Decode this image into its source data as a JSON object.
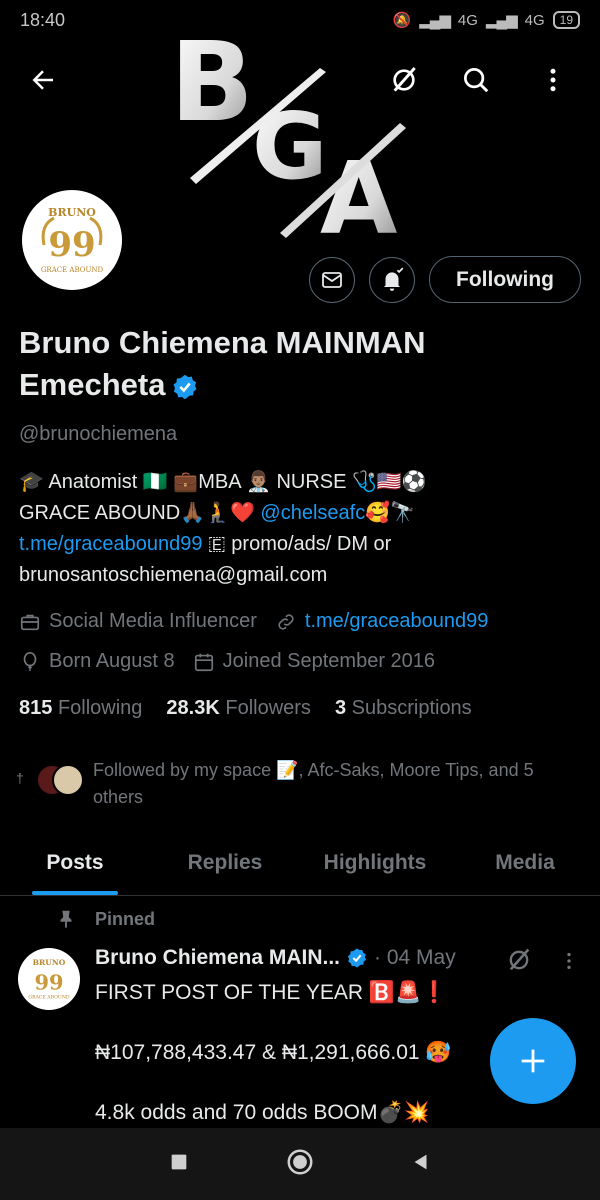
{
  "status_bar": {
    "time": "18:40",
    "network_1": "4G",
    "network_2": "4G",
    "battery": "19"
  },
  "banner": {
    "logo_text": "BGA"
  },
  "avatar": {
    "top_text": "BRUNO",
    "number": "99",
    "bottom_text": "GRACE ABOUND"
  },
  "profile": {
    "following_button": "Following",
    "name_line1": "Bruno Chiemena MAINMAN",
    "name_line2": "Emecheta",
    "handle": "@brunochiemena",
    "bio": {
      "line1": "🎓 Anatomist 🇳🇬 💼MBA 👨🏽‍⚕️ NURSE 🩺🇺🇸⚽",
      "line2_a": "GRACE ABOUND🙏🏾🧎❤️ ",
      "line2_link": "@chelseafc",
      "line2_b": "🥰🔭",
      "line3_link": "t.me/graceabound99",
      "line3_b": " 🇪 promo/ads/ DM or",
      "line4": "brunosantoschiemena@gmail.com"
    },
    "category": "Social Media Influencer",
    "website": "t.me/graceabound99",
    "born": "Born August 8",
    "joined": "Joined September 2016",
    "following_count": "815",
    "following_label": "Following",
    "followers_count": "28.3K",
    "followers_label": "Followers",
    "subs_count": "3",
    "subs_label": "Subscriptions",
    "followed_by": "Followed by my space 📝, Afc-Saks, Moore Tips, and 5 others"
  },
  "tabs": [
    "Posts",
    "Replies",
    "Highlights",
    "Media"
  ],
  "post": {
    "pinned_label": "Pinned",
    "author": "Bruno Chiemena MAIN...",
    "date": "· 04 May",
    "line1": "FIRST POST OF THE YEAR 🅱️🚨❗",
    "line2": "₦107,788,433.47 & ₦1,291,666.01 🥵",
    "line3": "4.8k odds and 70 odds BOOM💣💥"
  },
  "colors": {
    "accent": "#1d9bf0",
    "background": "#000000",
    "text": "#e7e9ea",
    "muted": "#71767b"
  }
}
